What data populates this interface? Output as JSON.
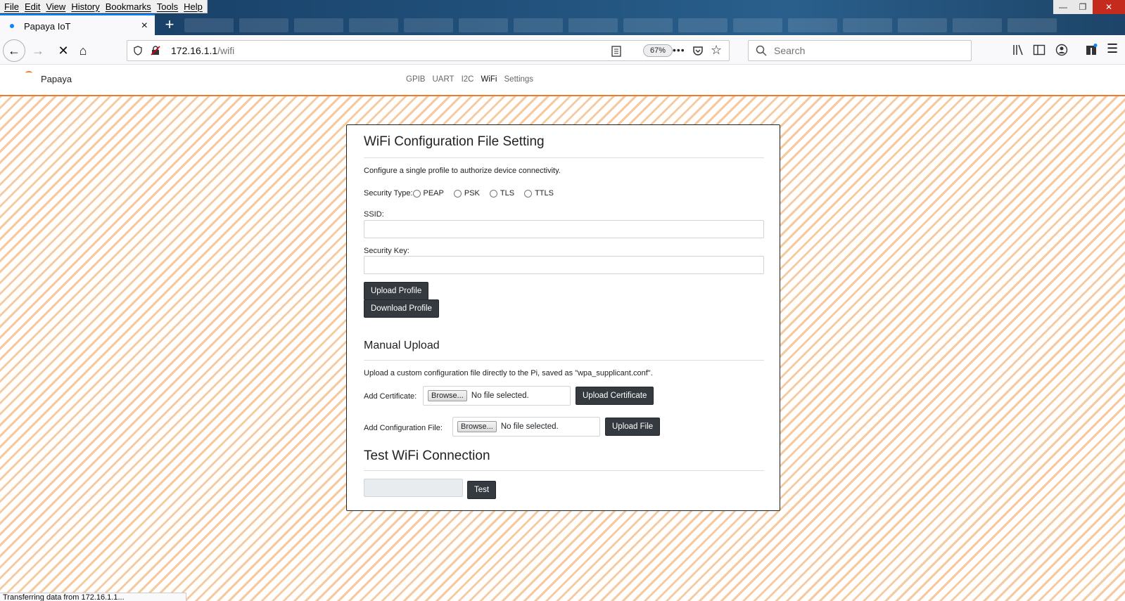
{
  "menubar": {
    "items": [
      "File",
      "Edit",
      "View",
      "History",
      "Bookmarks",
      "Tools",
      "Help"
    ]
  },
  "window_controls": {
    "minimize": "—",
    "maximize": "❐",
    "close": "✕"
  },
  "tab": {
    "title": "Papaya IoT",
    "close": "×",
    "new_tab": "+"
  },
  "navbar": {
    "back": "←",
    "forward": "→",
    "stop": "✕",
    "home": "⌂",
    "url_host": "172.16.1.1",
    "url_path": "/wifi",
    "zoom": "67%",
    "more": "•••",
    "search_placeholder": "Search"
  },
  "site": {
    "brand": "Papaya",
    "nav": [
      "GPIB",
      "UART",
      "I2C",
      "WiFi",
      "Settings"
    ],
    "active_nav": "WiFi"
  },
  "config": {
    "title": "WiFi Configuration File Setting",
    "description": "Configure a single profile to authorize device connectivity.",
    "security_type_label": "Security Type:",
    "security_options": [
      "PEAP",
      "PSK",
      "TLS",
      "TTLS"
    ],
    "ssid_label": "SSID:",
    "ssid_value": "",
    "key_label": "Security Key:",
    "key_value": "",
    "upload_profile": "Upload Profile",
    "download_profile": "Download Profile"
  },
  "manual": {
    "title": "Manual Upload",
    "description": "Upload a custom configuration file directly to the Pi, saved as \"wpa_supplicant.conf\".",
    "cert_label": "Add Certificate:",
    "browse": "Browse...",
    "no_file": "No file selected.",
    "upload_cert": "Upload Certificate",
    "config_label": "Add Configuration File:",
    "upload_file": "Upload File"
  },
  "test": {
    "title": "Test WiFi Connection",
    "input_value": "",
    "button": "Test"
  },
  "status": "Transferring data from 172.16.1.1..."
}
